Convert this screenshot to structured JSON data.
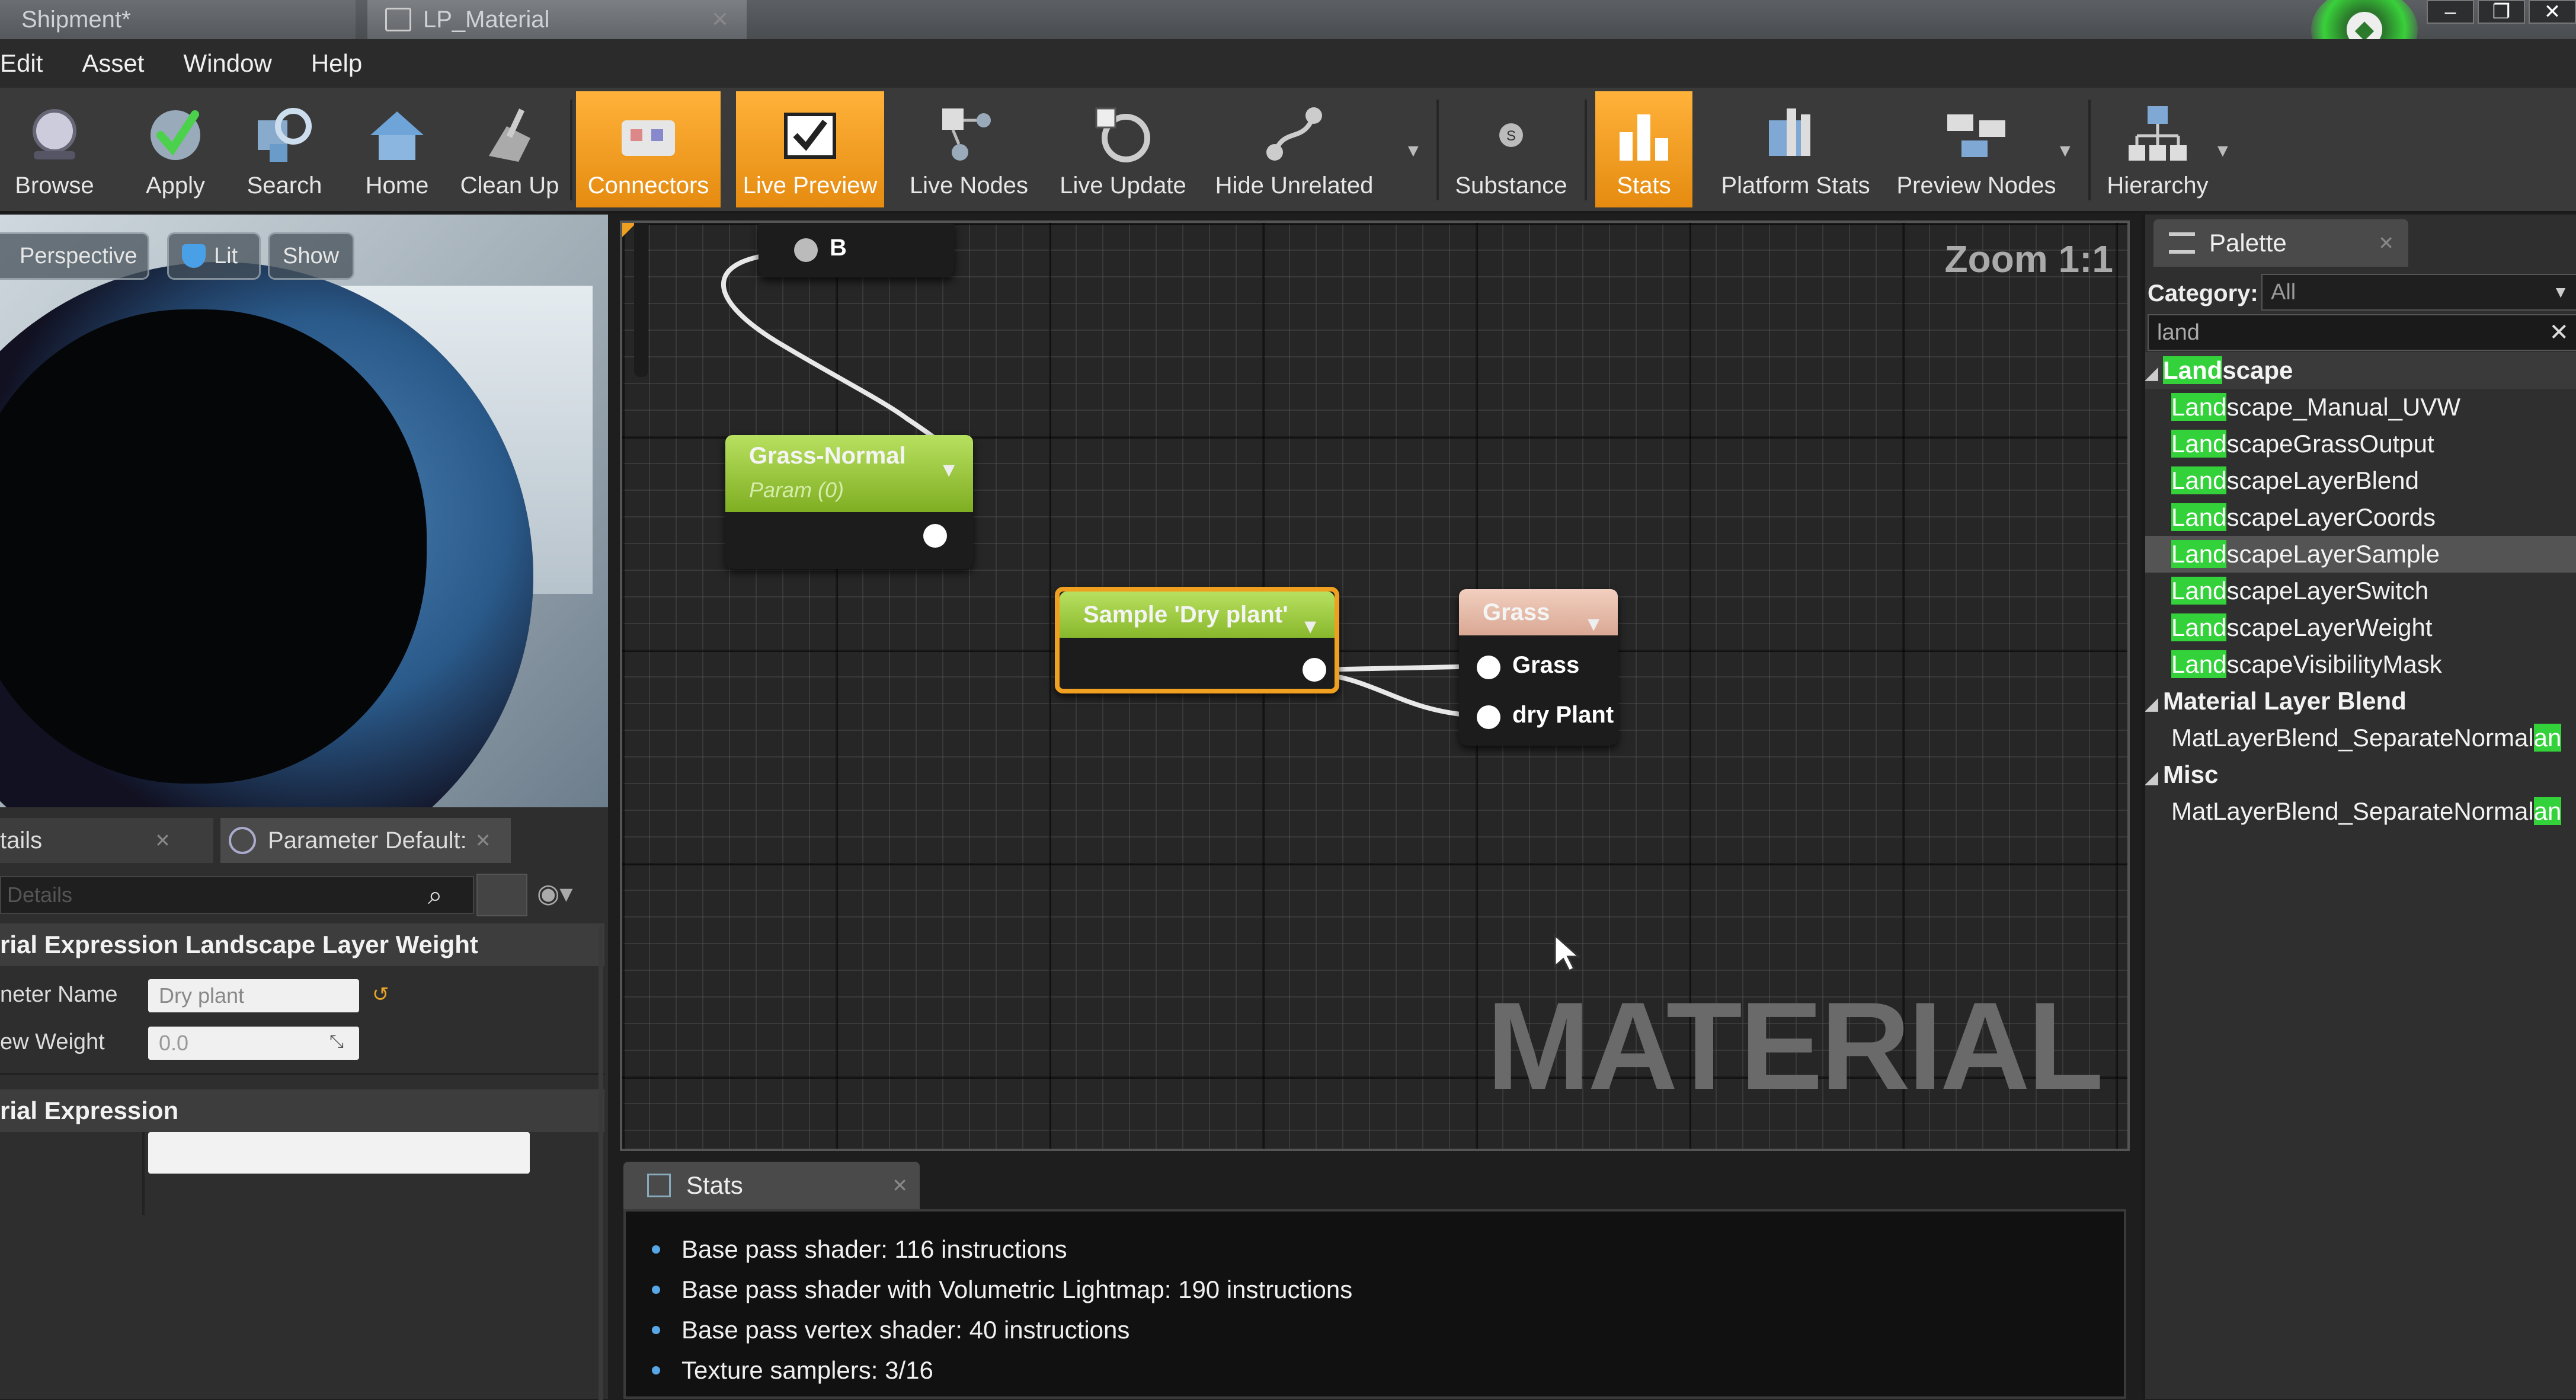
{
  "window": {
    "tabs": [
      {
        "label": "Shipment*"
      },
      {
        "label": "LP_Material"
      }
    ],
    "controls": [
      "–",
      "❐",
      "✕"
    ]
  },
  "menu": [
    "Edit",
    "Asset",
    "Window",
    "Help"
  ],
  "toolbar": [
    {
      "label": "Browse",
      "icon": "browse-icon"
    },
    {
      "label": "Apply",
      "icon": "apply-check-icon"
    },
    {
      "label": "Search",
      "icon": "search-icon"
    },
    {
      "label": "Home",
      "icon": "home-icon"
    },
    {
      "label": "Clean Up",
      "icon": "cleanup-broom-icon"
    },
    {
      "label": "Connectors",
      "icon": "connectors-icon",
      "active": true
    },
    {
      "label": "Live Preview",
      "icon": "live-preview-icon",
      "active": true
    },
    {
      "label": "Live Nodes",
      "icon": "live-nodes-icon"
    },
    {
      "label": "Live Update",
      "icon": "live-update-icon"
    },
    {
      "label": "Hide Unrelated",
      "icon": "hide-unrelated-icon"
    },
    {
      "label": "Substance",
      "icon": "substance-icon"
    },
    {
      "label": "Stats",
      "icon": "stats-icon",
      "active": true
    },
    {
      "label": "Platform Stats",
      "icon": "platform-stats-icon"
    },
    {
      "label": "Preview Nodes",
      "icon": "preview-nodes-icon"
    },
    {
      "label": "Hierarchy",
      "icon": "hierarchy-icon"
    }
  ],
  "viewport": {
    "perspective": "Perspective",
    "lit": "Lit",
    "show": "Show"
  },
  "details": {
    "tabs": [
      {
        "label": "tails"
      },
      {
        "label": "Parameter Default:"
      }
    ],
    "search_placeholder": "Details",
    "section1": "rial Expression Landscape Layer Weight",
    "param_name_label": "neter Name",
    "param_name_value": "Dry plant",
    "preview_weight_label": "ew Weight",
    "preview_weight_value": "0.0",
    "section2": "rial Expression"
  },
  "graph": {
    "zoom": "Zoom 1:1",
    "watermark": "MATERIAL",
    "nodes": {
      "b_pin": "B",
      "grass_normal_title": "Grass-Normal",
      "grass_normal_sub": "Param (0)",
      "sample_title": "Sample 'Dry plant'",
      "grass_title": "Grass",
      "grass_pin1": "Grass",
      "grass_pin2": "dry Plant"
    }
  },
  "stats": {
    "tab": "Stats",
    "lines": [
      "Base pass shader: 116 instructions",
      "Base pass shader with Volumetric Lightmap: 190 instructions",
      "Base pass vertex shader: 40 instructions",
      "Texture samplers: 3/16"
    ]
  },
  "palette": {
    "tab": "Palette",
    "category_label": "Category:",
    "category_value": "All",
    "search_value": "land",
    "items": [
      {
        "hl": "Land",
        "rest": "scape",
        "header": true
      },
      {
        "hl": "Land",
        "rest": "scape_Manual_UVW"
      },
      {
        "hl": "Land",
        "rest": "scapeGrassOutput"
      },
      {
        "hl": "Land",
        "rest": "scapeLayerBlend"
      },
      {
        "hl": "Land",
        "rest": "scapeLayerCoords"
      },
      {
        "hl": "Land",
        "rest": "scapeLayerSample",
        "selected": true
      },
      {
        "hl": "Land",
        "rest": "scapeLayerSwitch"
      },
      {
        "hl": "Land",
        "rest": "scapeLayerWeight"
      },
      {
        "hl": "Land",
        "rest": "scapeVisibilityMask"
      },
      {
        "pre": "Material Layer Blend",
        "header": true
      },
      {
        "pre": "MatLayerBlend_SeparateNormal",
        "hl": "an"
      },
      {
        "pre": "Misc",
        "header": true
      },
      {
        "pre": "MatLayerBlend_SeparateNormal",
        "hl": "an"
      }
    ]
  },
  "colors": {
    "accent_orange": "#f0a020",
    "highlight_green": "#33d13a",
    "node_green": "#9ccf3a",
    "node_pink": "#e8bba8"
  }
}
